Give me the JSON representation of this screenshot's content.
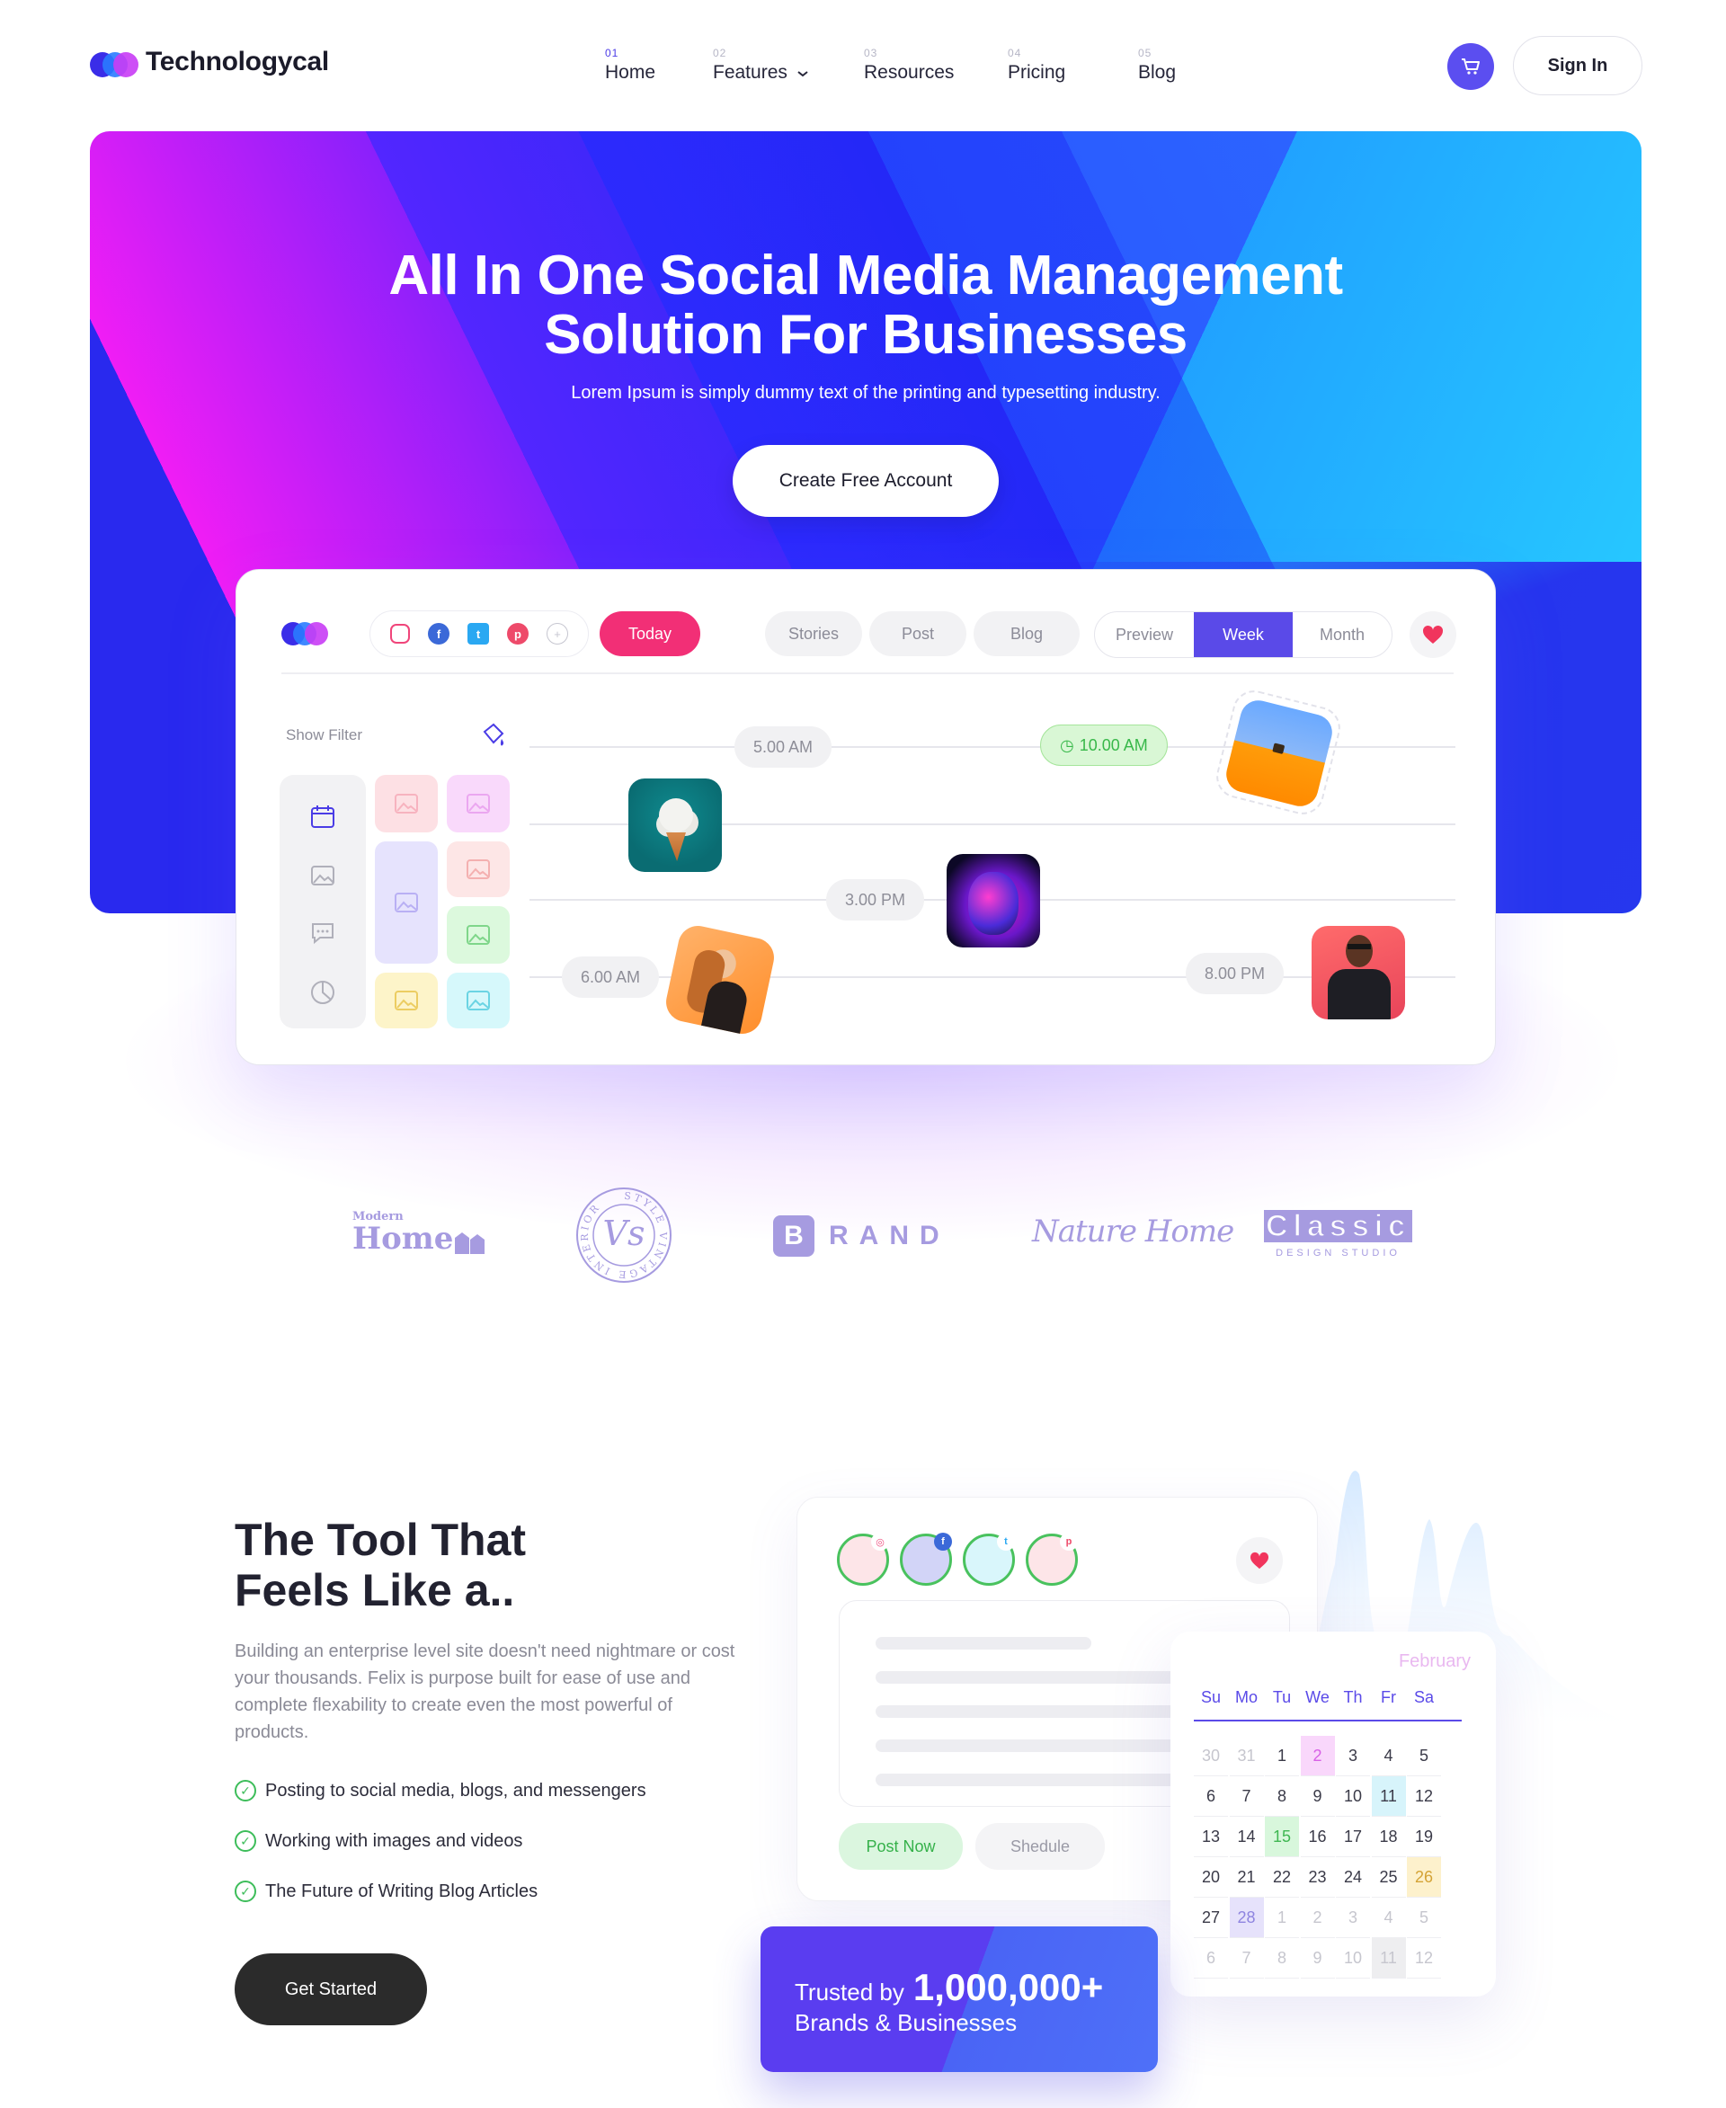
{
  "header": {
    "brand": "Technologycal",
    "nav": [
      {
        "num": "01",
        "label": "Home"
      },
      {
        "num": "02",
        "label": "Features"
      },
      {
        "num": "03",
        "label": "Resources"
      },
      {
        "num": "04",
        "label": "Pricing"
      },
      {
        "num": "05",
        "label": "Blog"
      }
    ],
    "signin": "Sign In"
  },
  "hero": {
    "title_line1": "All In One Social Media Management",
    "title_line2": "Solution For Businesses",
    "subtitle": "Lorem Ipsum is simply dummy text of the printing and typesetting industry.",
    "cta": "Create Free Account"
  },
  "dashboard": {
    "today": "Today",
    "tabs": [
      "Stories",
      "Post",
      "Blog"
    ],
    "views": [
      "Preview",
      "Week",
      "Month"
    ],
    "active_view": "Week",
    "filter_label": "Show Filter",
    "times": [
      "5.00 AM",
      "10.00 AM",
      "3.00 PM",
      "6.00 AM",
      "8.00 PM"
    ]
  },
  "brands": {
    "modern_small": "Modern",
    "modern_big": "Home",
    "vs": "Vs",
    "vs_ring": "STYLE VINTAGE INTERIOR",
    "brand_b": "B",
    "brand_rest": "RAND",
    "nature": "Nature Home",
    "classic": "Classic",
    "classic_sub": "DESIGN STUDIO"
  },
  "tool": {
    "title_line1": "The Tool That",
    "title_line2": "Feels Like a..",
    "body": "Building an enterprise level site doesn't need nightmare or cost your thousands. Felix is purpose built for ease of use and complete flexability to create even the most powerful of products.",
    "checks": [
      "Posting to social media, blogs, and messengers",
      "Working with images and videos",
      "The Future of Writing Blog Articles"
    ],
    "button": "Get Started"
  },
  "composer": {
    "post_now": "Post Now",
    "schedule": "Shedule"
  },
  "calendar": {
    "month": "February",
    "days": [
      "Su",
      "Mo",
      "Tu",
      "We",
      "Th",
      "Fr",
      "Sa"
    ],
    "weeks": [
      [
        "30",
        "31",
        "1",
        "2",
        "3",
        "4",
        "5"
      ],
      [
        "6",
        "7",
        "8",
        "9",
        "10",
        "11",
        "12"
      ],
      [
        "13",
        "14",
        "15",
        "16",
        "17",
        "18",
        "19"
      ],
      [
        "20",
        "21",
        "22",
        "23",
        "24",
        "25",
        "26"
      ],
      [
        "27",
        "28",
        "1",
        "2",
        "3",
        "4",
        "5"
      ],
      [
        "6",
        "7",
        "8",
        "9",
        "10",
        "11",
        "12"
      ]
    ]
  },
  "trusted": {
    "prefix": "Trusted by",
    "number": "1,000,000+",
    "line2": "Brands & Businesses"
  },
  "colors": {
    "accent": "#5a4ae8",
    "pink": "#f22f76",
    "green": "#3dbd5a"
  }
}
